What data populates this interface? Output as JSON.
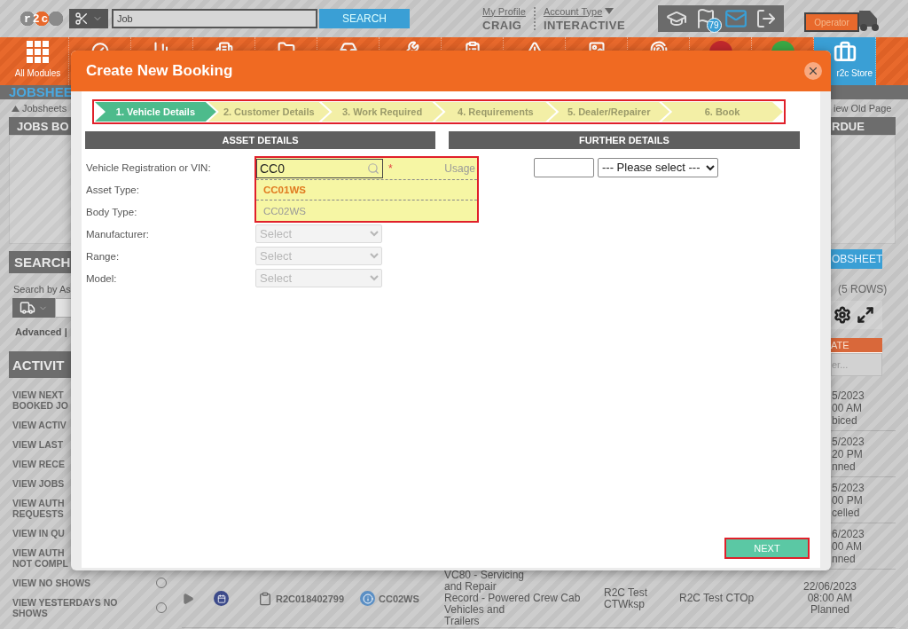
{
  "header": {
    "logo": "r2c",
    "search": {
      "value": "Job"
    },
    "search_button": "SEARCH",
    "profile_link": "My Profile",
    "user_name": "CRAIG",
    "account_link": "Account Type",
    "account_type": "INTERACTIVE",
    "notification_count": "79",
    "operator_label": "Operator"
  },
  "modules": [
    {
      "label": "All Modules",
      "selected": false
    },
    {
      "selected": false
    },
    {
      "selected": false
    },
    {
      "selected": false
    },
    {
      "selected": false
    },
    {
      "selected": false
    },
    {
      "selected": false
    },
    {
      "selected": false
    },
    {
      "selected": false
    },
    {
      "selected": false
    },
    {
      "selected": false
    },
    {
      "color": "#c0282d",
      "selected": false
    },
    {
      "color": "#3aa845",
      "selected": false
    },
    {
      "label": "r2c Store",
      "selected": true
    }
  ],
  "page_title": "JOBSHEE",
  "sidebar": {
    "breadcrumb": "Jobsheets",
    "jobs_panel_title": "JOBS BO",
    "search_title": "SEARCH",
    "search_hint": "Search by As",
    "advanced": "Advanced |",
    "activity_title": "ACTIVIT",
    "activity_items": [
      {
        "text": "VIEW NEXT\nBOOKED JO"
      },
      {
        "text": "VIEW ACTIV"
      },
      {
        "text": "VIEW LAST"
      },
      {
        "text": "VIEW RECE"
      },
      {
        "text": "VIEW JOBS"
      },
      {
        "text": "VIEW AUTH\nREQUESTS"
      },
      {
        "text": "VIEW IN QU"
      },
      {
        "text": "VIEW AUTH\nNOT COMPL"
      },
      {
        "text": "VIEW NO SHOWS",
        "selected": false
      },
      {
        "text": "VIEW YESTERDAYS NO\nSHOWS",
        "selected": false
      }
    ]
  },
  "right_panel": {
    "old_page_link": "iew Old Page",
    "overdue_title": "RDUE",
    "new_jobsheet_button": "OBSHEET",
    "row_count": "(5 ROWS)",
    "filter_column": "ATE",
    "filter_placeholder": "er..."
  },
  "jobs_table": {
    "rows": [
      {
        "date": "5/2023\n00 AM\nbiced"
      },
      {
        "date": "5/2023\n20 PM\nnned"
      },
      {
        "date": "5/2023\n00 PM\ncelled"
      },
      {
        "date": "6/2023\n00 AM\nnned"
      },
      {
        "job_number": "R2C018402799",
        "registration": "CC02WS",
        "description": "VC80 - Servicing and Repair Record - Powered Vehicles and Trailers",
        "body_type": "Crew Cab",
        "workshop": "R2C Test\nCTWksp",
        "operator": "R2C Test CTOp",
        "date": "22/06/2023\n08:00 AM\nPlanned"
      }
    ]
  },
  "modal": {
    "title": "Create New Booking",
    "steps_highlighted": true,
    "steps": [
      {
        "label": "1. Vehicle Details",
        "selected": true
      },
      {
        "label": "2. Customer Details",
        "selected": false
      },
      {
        "label": "3. Work Required",
        "selected": false
      },
      {
        "label": "4. Requirements",
        "selected": false
      },
      {
        "label": "5. Dealer/Repairer",
        "selected": false
      },
      {
        "label": "6. Book",
        "selected": false
      }
    ],
    "asset_header": "ASSET DETAILS",
    "further_header": "FURTHER DETAILS",
    "fields": [
      {
        "kind": "lookup",
        "label": "Vehicle Registration or VIN:",
        "value": "CC0",
        "required_mark": "*",
        "side_label": "Usage",
        "highlighted": true,
        "suggestions": [
          {
            "text": "CC01WS",
            "selected": true
          },
          {
            "text": "CC02WS",
            "selected": false
          }
        ]
      },
      {
        "kind": "label",
        "label": "Asset Type:"
      },
      {
        "kind": "label",
        "label": "Body Type:"
      },
      {
        "kind": "select",
        "label": "Manufacturer:",
        "value": "Select",
        "disabled": true
      },
      {
        "kind": "select",
        "label": "Range:",
        "value": "Select",
        "disabled": true
      },
      {
        "kind": "select",
        "label": "Model:",
        "value": "Select",
        "disabled": true
      }
    ],
    "further_select": "--- Please select ---",
    "next_button": {
      "label": "NEXT",
      "highlighted": true
    }
  }
}
